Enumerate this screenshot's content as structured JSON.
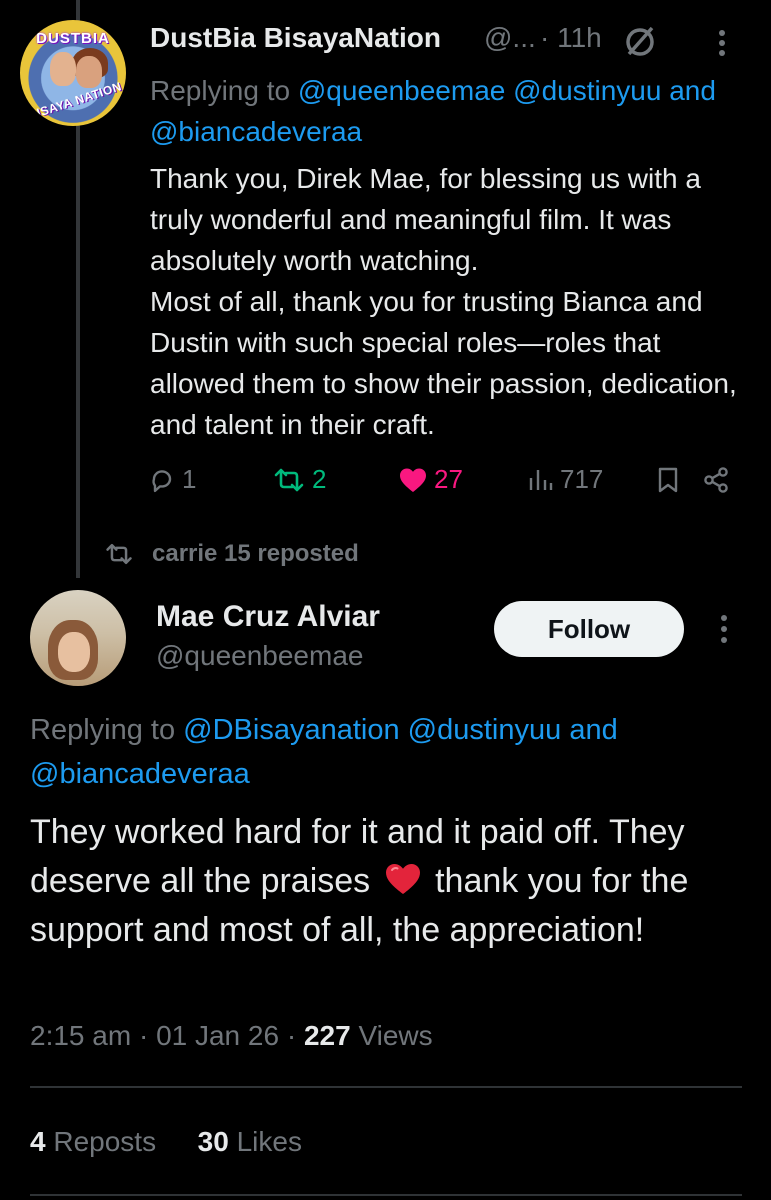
{
  "tweet1": {
    "author_name": "DustBia BisayaNation",
    "author_handle": "@...",
    "time": "· 11h",
    "avatar_text_top": "DUSTBIA",
    "avatar_text_bottom": "BISAYA NATION",
    "reply_prefix": "Replying to",
    "reply_mention_1": "@queenbeemae",
    "reply_mention_2": "@dustinyuu",
    "reply_and": "and",
    "reply_mention_3": "@biancadeveraa",
    "body_line1": "Thank you, Direk Mae, for blessing us with a truly wonderful and meaningful film. It was absolutely worth watching.",
    "body_line2": "Most of all, thank you for trusting Bianca and Dustin with such special roles—roles that allowed them to show their passion, dedication, and talent in their craft.",
    "replies": "1",
    "reposts": "2",
    "likes": "27",
    "views": "717"
  },
  "repost_banner": {
    "text": "carrie 15 reposted"
  },
  "tweet2": {
    "author_name": "Mae Cruz Alviar",
    "author_handle": "@queenbeemae",
    "follow_label": "Follow",
    "reply_prefix": "Replying to",
    "reply_mention_1": "@DBisayanation",
    "reply_mention_2": "@dustinyuu",
    "reply_and": "and",
    "reply_mention_3": "@biancadeveraa",
    "body_part1": "They worked hard for it and it paid off. They deserve all the praises",
    "body_part2": "thank you for the support and most of all, the appreciation!",
    "time": "2:15 am",
    "date": "01 Jan 26",
    "views_count": "227",
    "views_label": "Views",
    "reposts_count": "4",
    "reposts_label": "Reposts",
    "likes_count": "30",
    "likes_label": "Likes"
  },
  "colors": {
    "background": "#000000",
    "text_primary": "#e7e9ea",
    "text_secondary": "#71767b",
    "link": "#1d9bf0",
    "repost_green": "#00ba7c",
    "like_pink": "#f91880"
  },
  "icons": [
    "grok-icon",
    "more-icon",
    "reply-icon",
    "repost-icon",
    "heart-icon",
    "views-icon",
    "bookmark-icon",
    "share-icon",
    "heart-emoji"
  ]
}
